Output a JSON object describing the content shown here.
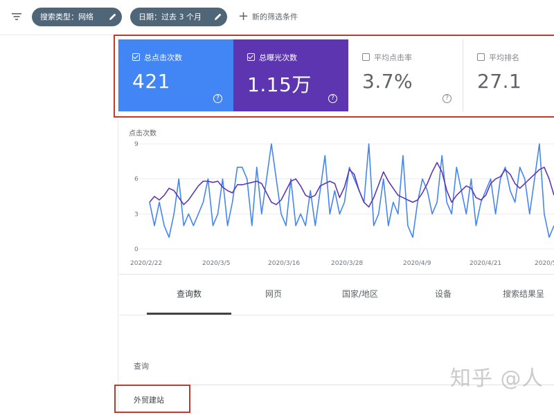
{
  "filters": {
    "search_type": "搜索类型：网络",
    "date": "日期：过去 3 个月",
    "new_filter": "新的筛选条件"
  },
  "metrics": [
    {
      "label": "总点击次数",
      "value": "421",
      "checked": true,
      "color": "#4285f4"
    },
    {
      "label": "总曝光次数",
      "value": "1.15万",
      "checked": true,
      "color": "#5e35b1"
    },
    {
      "label": "平均点击率",
      "value": "3.7%",
      "checked": false
    },
    {
      "label": "平均排名",
      "value": "27.1",
      "checked": false
    }
  ],
  "chart_data": {
    "type": "line",
    "ylabel": "点击次数",
    "y_ticks": [
      "9",
      "6",
      "3",
      "0"
    ],
    "x_ticks": [
      "2020/2/22",
      "2020/3/5",
      "2020/3/16",
      "2020/3/28",
      "2020/4/9",
      "2020/4/21",
      "2020/5/"
    ],
    "ylim": [
      0,
      9
    ],
    "series": [
      {
        "color": "#4285f4",
        "values": [
          4,
          2,
          4,
          2,
          1,
          3,
          6,
          2,
          3,
          2,
          3,
          4,
          6,
          2,
          3,
          6,
          2,
          4,
          7,
          7,
          6,
          2,
          7,
          3,
          6,
          9,
          6,
          3,
          2,
          6,
          2,
          3,
          2,
          5,
          2,
          5,
          8,
          3,
          5,
          3,
          4,
          7,
          6,
          5,
          4,
          9,
          2,
          3,
          6,
          2,
          4,
          3,
          8,
          2,
          1,
          4,
          6,
          5,
          3,
          4,
          8,
          4,
          3,
          7,
          5,
          3,
          6,
          2,
          4,
          5,
          6,
          3,
          6,
          7,
          5,
          4,
          7,
          6,
          3,
          6,
          9,
          3,
          1,
          2
        ]
      },
      {
        "color": "#5e35b1",
        "values": [
          4,
          4.5,
          4.2,
          4.6,
          5.2,
          5.0,
          4.4,
          3.8,
          4.2,
          4.8,
          5.4,
          5.8,
          5.8,
          5.7,
          5.8,
          5.3,
          5.0,
          4.8,
          5.5,
          5.5,
          5.6,
          5.7,
          5.8,
          5.6,
          4.8,
          4.0,
          3.8,
          4.2,
          5.0,
          5.8,
          6.0,
          5.4,
          4.6,
          4.4,
          4.6,
          5.4,
          5.6,
          5.8,
          5.6,
          4.4,
          5.3,
          6.8,
          6.4,
          5.0,
          4.0,
          3.6,
          4.4,
          5.5,
          6.6,
          5.8,
          5.2,
          4.6,
          4.4,
          4.2,
          4.0,
          4.2,
          4.8,
          5.6,
          6.6,
          7.4,
          6.6,
          5.0,
          4.0,
          4.6,
          5.0,
          5.4,
          5.2,
          4.4,
          4.2,
          4.6,
          5.6,
          6.0,
          6.2,
          6.8,
          6.4,
          5.6,
          5.2,
          5.6,
          6.0,
          6.4,
          6.8,
          7.0,
          6.0,
          4.6
        ]
      }
    ]
  },
  "tabs": [
    "查询数",
    "网页",
    "国家/地区",
    "设备",
    "搜索结果呈"
  ],
  "table": {
    "header": "查询",
    "rows": [
      "外贸建站"
    ]
  },
  "watermark": "知乎 @人"
}
